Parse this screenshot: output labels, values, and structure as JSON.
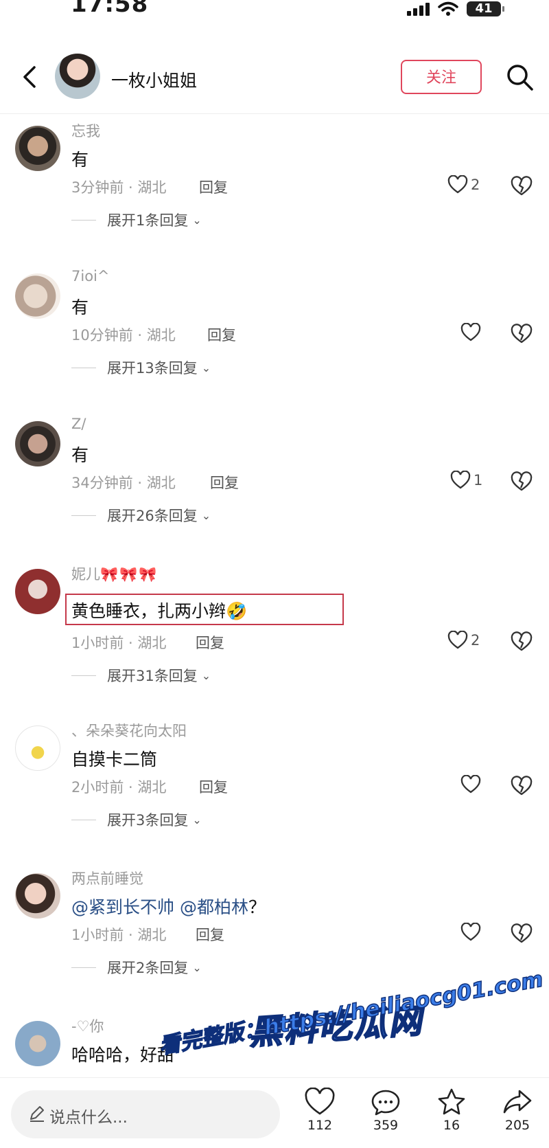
{
  "status": {
    "time": "17:58",
    "battery": "41"
  },
  "header": {
    "title": "一枚小姐姐",
    "follow_label": "关注"
  },
  "comments": [
    {
      "name": "忘我",
      "bows": "",
      "text": "有",
      "time": "3分钟前 · 湖北",
      "reply": "回复",
      "likes": "2",
      "expand": "展开1条回复"
    },
    {
      "name": "7ioi^",
      "bows": "",
      "text": "有",
      "time": "10分钟前 · 湖北",
      "reply": "回复",
      "likes": "",
      "expand": "展开13条回复"
    },
    {
      "name": "Z/",
      "bows": "",
      "text": "有",
      "time": "34分钟前 · 湖北",
      "reply": "回复",
      "likes": "1",
      "expand": "展开26条回复"
    },
    {
      "name": "妮儿",
      "bows": "🎀🎀🎀",
      "text": "黄色睡衣，扎两小辫🤣",
      "time": "1小时前 · 湖北",
      "reply": "回复",
      "likes": "2",
      "expand": "展开31条回复"
    },
    {
      "name": "、朵朵葵花向太阳",
      "bows": "",
      "text": "自摸卡二筒",
      "time": "2小时前 · 湖北",
      "reply": "回复",
      "likes": "",
      "expand": "展开3条回复"
    },
    {
      "name": "两点前睡觉",
      "bows": "",
      "mentions": [
        "@紧到长不帅",
        "@都柏林"
      ],
      "suffix": "？",
      "time": "1小时前 · 湖北",
      "reply": "回复",
      "likes": "",
      "expand": "展开2条回复"
    },
    {
      "name": "-♡你",
      "bows": "",
      "text": "哈哈哈，好甜"
    }
  ],
  "watermark": {
    "line1": "黑料吃瓜网",
    "line2": "看完整版：https://heiliaocg01.com"
  },
  "bottom": {
    "placeholder": "说点什么...",
    "likes": "112",
    "comments": "359",
    "favorites": "16",
    "shares": "205"
  }
}
